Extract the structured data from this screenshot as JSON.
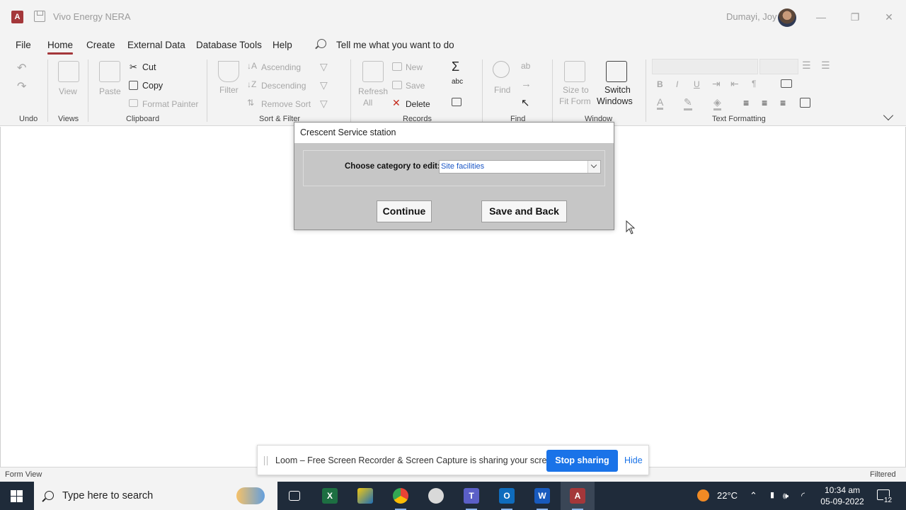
{
  "titlebar": {
    "app_badge": "A",
    "doc_title": "Vivo Energy NERA",
    "user_name": "Dumayi, Joy",
    "minimize": "—",
    "restore": "❐",
    "close": "✕"
  },
  "menu": {
    "tabs": [
      "File",
      "Home",
      "Create",
      "External Data",
      "Database Tools",
      "Help"
    ],
    "active": "Home",
    "tell_me": "Tell me what you want to do"
  },
  "ribbon": {
    "groups": {
      "undo": "Undo",
      "views": "Views",
      "clipboard": "Clipboard",
      "sort_filter": "Sort & Filter",
      "records": "Records",
      "find": "Find",
      "window": "Window",
      "text_formatting": "Text Formatting"
    },
    "view": "View",
    "paste": "Paste",
    "cut": "Cut",
    "copy": "Copy",
    "format_painter": "Format Painter",
    "filter": "Filter",
    "ascending": "Ascending",
    "descending": "Descending",
    "remove_sort": "Remove Sort",
    "refresh": "Refresh",
    "all": "All",
    "new": "New",
    "save": "Save",
    "delete": "Delete",
    "find": "Find",
    "size_to": "Size to",
    "fit_form": "Fit Form",
    "switch": "Switch",
    "windows": "Windows",
    "bold": "B",
    "italic": "I",
    "underline": "U",
    "font_color": "A"
  },
  "dialog": {
    "title": "Crescent Service station",
    "label": "Choose category to edit:",
    "selected": "Site facilities",
    "continue": "Continue",
    "save_back": "Save and Back"
  },
  "status": {
    "left": "Form View",
    "right": "Filtered"
  },
  "loom": {
    "message": "Loom – Free Screen Recorder & Screen Capture is sharing your screen.",
    "stop": "Stop sharing",
    "hide": "Hide"
  },
  "taskbar": {
    "search_placeholder": "Type here to search",
    "temperature": "22°C",
    "time": "10:34 am",
    "date": "05-09-2022",
    "notifications": "12"
  }
}
